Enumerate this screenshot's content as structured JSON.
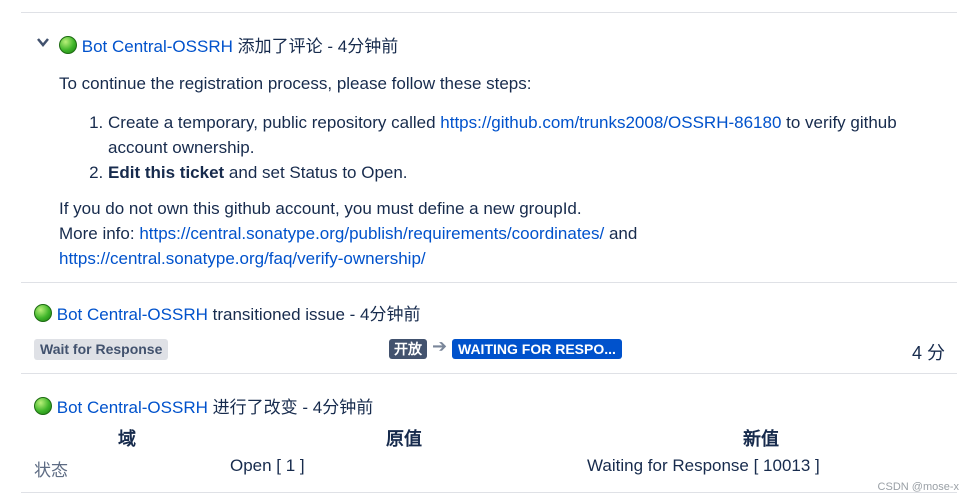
{
  "comment": {
    "author": "Bot Central-OSSRH",
    "action": "添加了评论 - 4分钟前",
    "intro": "To continue the registration process, please follow these steps:",
    "step1_pre": "Create a temporary, public repository called ",
    "step1_link": "https://github.com/trunks2008/OSSRH-86180",
    "step1_post": " to verify github account ownership.",
    "step2_bold": "Edit this ticket",
    "step2_post": " and set Status to Open.",
    "note1": "If you do not own this github account, you must define a new groupId.",
    "note2_pre": "More info: ",
    "note2_link1": "https://central.sonatype.org/publish/requirements/coordinates/",
    "note2_and": " and",
    "note2_link2": "https://central.sonatype.org/faq/verify-ownership/"
  },
  "transition": {
    "author": "Bot Central-OSSRH",
    "action": "transitioned issue - 4分钟前",
    "status_label": "Wait for Response",
    "from_status": "开放",
    "arrow": "➔",
    "to_status": "WAITING FOR RESPO...",
    "duration": "4 分"
  },
  "change": {
    "author": "Bot Central-OSSRH",
    "action": "进行了改变 - 4分钟前",
    "headers": {
      "field": "域",
      "old": "原值",
      "new": "新值"
    },
    "row": {
      "field": "状态",
      "old": "Open [ 1 ]",
      "new": "Waiting for Response [ 10013 ]"
    }
  },
  "watermark": "CSDN @mose-x",
  "colors": {
    "link": "#0052cc",
    "text": "#172b4d",
    "blue_lozenge": "#0052cc",
    "dark_lozenge": "#42526e"
  }
}
